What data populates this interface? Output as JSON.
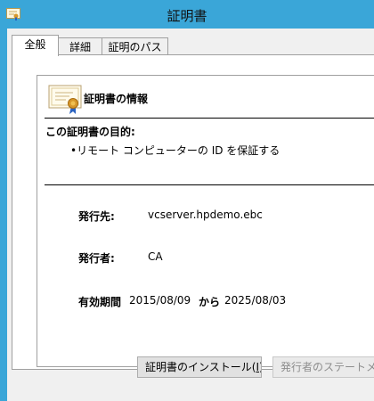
{
  "window": {
    "title": "証明書"
  },
  "tabs": [
    {
      "label": "全般",
      "active": true
    },
    {
      "label": "詳細",
      "active": false
    },
    {
      "label": "証明のパス",
      "active": false
    }
  ],
  "info": {
    "heading": "証明書の情報",
    "purpose_heading": "この証明書の目的:",
    "purposes": [
      "•リモート コンピューターの ID を保証する"
    ]
  },
  "details": {
    "issued_to_label": "発行先:",
    "issued_to_value": "vcserver.hpdemo.ebc",
    "issued_by_label": "発行者:",
    "issued_by_value": "CA",
    "validity_label": "有効期間",
    "valid_from": "2015/08/09",
    "from_word": "から",
    "valid_to": "2025/08/03"
  },
  "buttons": {
    "install_prefix": "証明書のインストール(",
    "install_accel": "I",
    "install_suffix": ")...",
    "issuer_statement": "発行者のステートメント"
  },
  "colors": {
    "titlebar": "#3aa6d8",
    "dialog_bg": "#f0f0f0",
    "seal": "#c8901c",
    "ribbon": "#2a62c0"
  },
  "icons": {
    "window_icon": "certificate-icon",
    "info_icon": "certificate-seal-icon"
  }
}
